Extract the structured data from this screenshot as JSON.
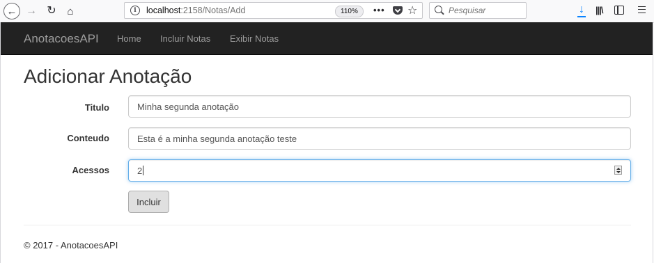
{
  "browser": {
    "url_host": "localhost",
    "url_rest": ":2158/Notas/Add",
    "zoom": "110%",
    "page_actions": "•••",
    "search_placeholder": "Pesquisar"
  },
  "navbar": {
    "brand": "AnotacoesAPI",
    "links": [
      "Home",
      "Incluir Notas",
      "Exibir Notas"
    ],
    "background": "#222222",
    "link_color": "#9d9d9d"
  },
  "page": {
    "title": "Adicionar Anotação"
  },
  "form": {
    "fields": [
      {
        "label": "Titulo",
        "value": "Minha segunda anotação"
      },
      {
        "label": "Conteudo",
        "value": "Esta é a minha segunda anotação teste"
      },
      {
        "label": "Acessos",
        "value": "2"
      }
    ],
    "submit_label": "Incluir",
    "focus_color": "#66afe9"
  },
  "footer": {
    "text": "© 2017 - AnotacoesAPI"
  },
  "icons": [
    "back-icon",
    "forward-icon",
    "reload-icon",
    "home-icon",
    "info-icon",
    "pocket-icon",
    "star-icon",
    "search-icon",
    "download-icon",
    "library-icon",
    "sidebar-icon",
    "menu-icon",
    "spinner-icon"
  ]
}
